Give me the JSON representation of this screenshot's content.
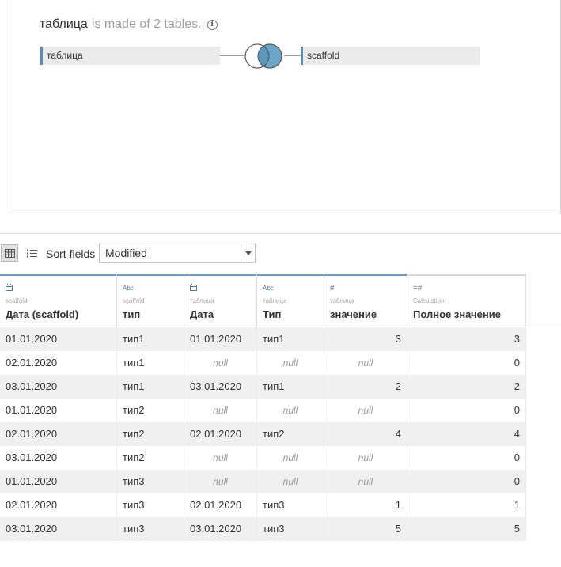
{
  "canvas": {
    "title": "таблица",
    "title_suffix": "is made of 2 tables.",
    "info_glyph": "i",
    "left_table": "таблица",
    "right_table": "scaffold",
    "join_icon": "full-outer-join-icon",
    "join_color": "#6aa6c7"
  },
  "toolbar": {
    "sort_label": "Sort fields",
    "sort_value": "Modified",
    "grid_view_icon": "grid-view-icon",
    "list_view_icon": "list-view-icon"
  },
  "columns": [
    {
      "type": "date",
      "source": "scaffold",
      "name": "Дата (scaffold)"
    },
    {
      "type": "Abc",
      "source": "scaffold",
      "name": "тип"
    },
    {
      "type": "date",
      "source": "таблица",
      "name": "Дата"
    },
    {
      "type": "Abc",
      "source": "таблица",
      "name": "Тип"
    },
    {
      "type": "#",
      "source": "таблица",
      "name": "значение"
    },
    {
      "type": "=#",
      "source": "Calculation",
      "name": "Полное значение"
    }
  ],
  "rows": [
    [
      "01.01.2020",
      "тип1",
      "01.01.2020",
      "тип1",
      "3",
      "3"
    ],
    [
      "02.01.2020",
      "тип1",
      "null",
      "null",
      "null",
      "0"
    ],
    [
      "03.01.2020",
      "тип1",
      "03.01.2020",
      "тип1",
      "2",
      "2"
    ],
    [
      "01.01.2020",
      "тип2",
      "null",
      "null",
      "null",
      "0"
    ],
    [
      "02.01.2020",
      "тип2",
      "02.01.2020",
      "тип2",
      "4",
      "4"
    ],
    [
      "03.01.2020",
      "тип2",
      "null",
      "null",
      "null",
      "0"
    ],
    [
      "01.01.2020",
      "тип3",
      "null",
      "null",
      "null",
      "0"
    ],
    [
      "02.01.2020",
      "тип3",
      "02.01.2020",
      "тип3",
      "1",
      "1"
    ],
    [
      "03.01.2020",
      "тип3",
      "03.01.2020",
      "тип3",
      "5",
      "5"
    ]
  ],
  "colors": {
    "accent": "#5b8db8",
    "header_strip": "#6b9bc3",
    "null_text": "#9a9a9a"
  }
}
